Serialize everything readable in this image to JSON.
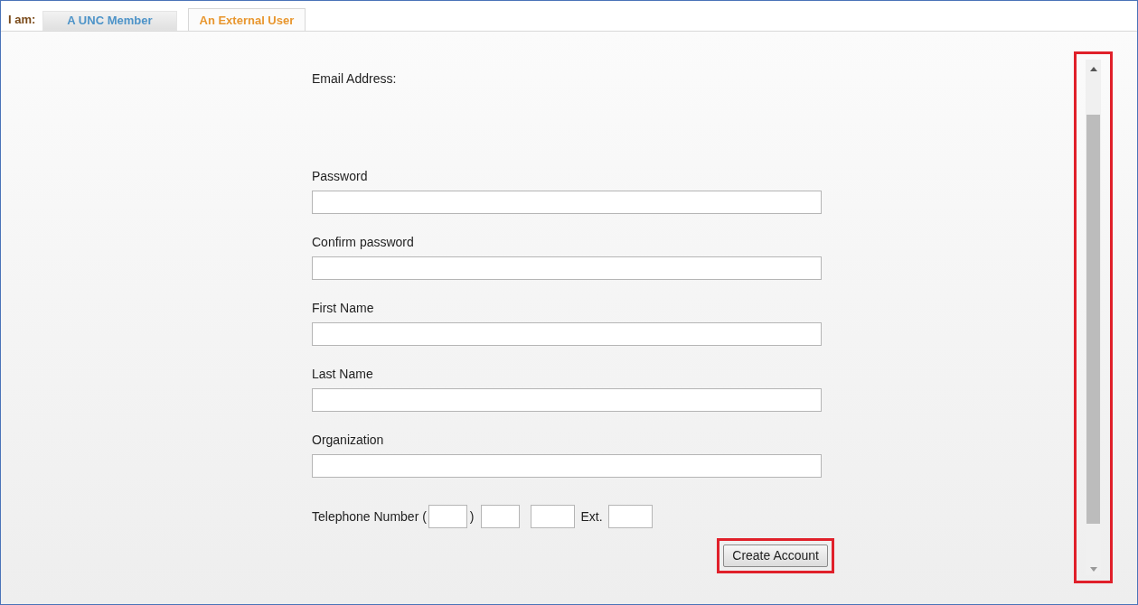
{
  "tab_bar": {
    "prefix": "I am:",
    "tabs": [
      {
        "label": "A UNC Member",
        "selected": false
      },
      {
        "label": "An External User",
        "selected": true
      }
    ]
  },
  "form": {
    "email_label": "Email Address:",
    "fields": [
      {
        "kind": "text",
        "label": "Password"
      },
      {
        "kind": "text",
        "label": "Confirm password"
      },
      {
        "kind": "text",
        "label": "First Name"
      },
      {
        "kind": "text",
        "label": "Last Name"
      },
      {
        "kind": "text",
        "label": "Organization"
      },
      {
        "kind": "phone",
        "label": "Telephone Number (",
        "close_paren": ")",
        "ext_label": "Ext."
      }
    ],
    "submit": "Create Account"
  }
}
